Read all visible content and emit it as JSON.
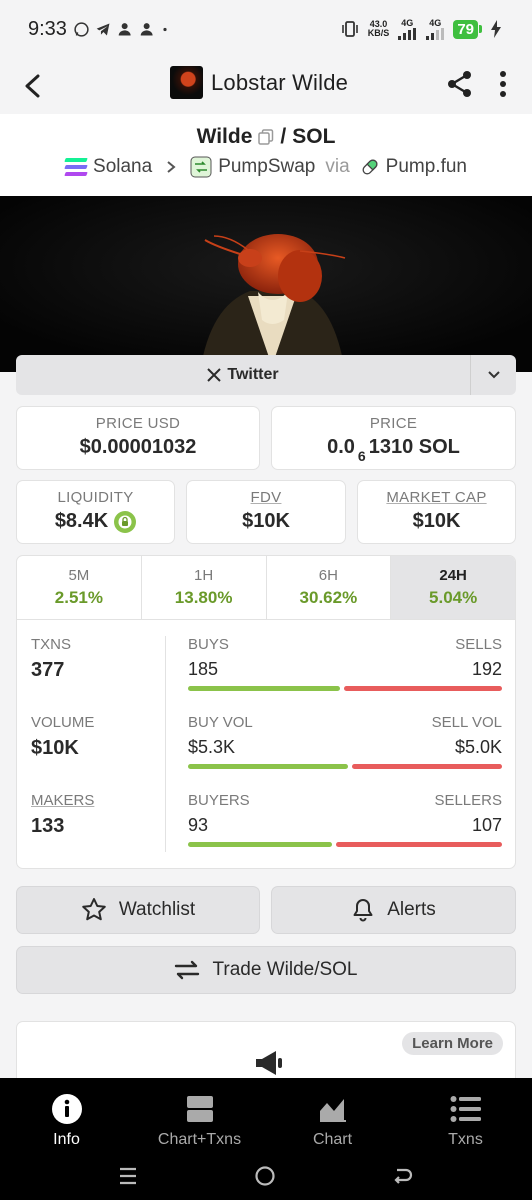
{
  "status_bar": {
    "time": "9:33",
    "net_speed_value": "43.0",
    "net_speed_unit": "KB/S",
    "net_type_1": "4G",
    "net_type_2": "4G",
    "battery": "79"
  },
  "header": {
    "title": "Lobstar Wilde"
  },
  "pair": {
    "base": "Wilde",
    "separator": "/",
    "quote": "SOL",
    "chain": "Solana",
    "dex": "PumpSwap",
    "via": "via",
    "launchpad": "Pump.fun"
  },
  "social": {
    "twitter_label": "Twitter"
  },
  "prices": {
    "price_usd_label": "PRICE USD",
    "price_usd_value": "$0.00001032",
    "price_label": "PRICE",
    "price_prefix": "0.0",
    "price_sub": "6",
    "price_suffix": "1310 SOL"
  },
  "metrics": {
    "liquidity_label": "LIQUIDITY",
    "liquidity_value": "$8.4K",
    "fdv_label": "FDV",
    "fdv_value": "$10K",
    "mcap_label": "MARKET CAP",
    "mcap_value": "$10K"
  },
  "timeframes": [
    {
      "label": "5M",
      "change": "2.51%"
    },
    {
      "label": "1H",
      "change": "13.80%"
    },
    {
      "label": "6H",
      "change": "30.62%"
    },
    {
      "label": "24H",
      "change": "5.04%"
    }
  ],
  "stats": {
    "txns_label": "TXNS",
    "txns_value": "377",
    "volume_label": "VOLUME",
    "volume_value": "$10K",
    "makers_label": "MAKERS",
    "makers_value": "133",
    "buys_label": "BUYS",
    "buys_value": "185",
    "sells_label": "SELLS",
    "sells_value": "192",
    "buy_vol_label": "BUY VOL",
    "buy_vol_value": "$5.3K",
    "sell_vol_label": "SELL VOL",
    "sell_vol_value": "$5.0K",
    "buyers_label": "BUYERS",
    "buyers_value": "93",
    "sellers_label": "SELLERS",
    "sellers_value": "107",
    "buys_ratio": 0.491,
    "buy_vol_ratio": 0.515,
    "buyers_ratio": 0.465
  },
  "actions": {
    "watchlist": "Watchlist",
    "alerts": "Alerts",
    "trade": "Trade Wilde/SOL"
  },
  "promo": {
    "learn_more": "Learn More"
  },
  "bottom_nav": [
    {
      "label": "Info",
      "active": true
    },
    {
      "label": "Chart+Txns",
      "active": false
    },
    {
      "label": "Chart",
      "active": false
    },
    {
      "label": "Txns",
      "active": false
    }
  ],
  "colors": {
    "accent_green": "#6a9a2a",
    "buy_bar": "#8bc34a",
    "sell_bar": "#e85c5c",
    "battery": "#3fbf3f"
  }
}
